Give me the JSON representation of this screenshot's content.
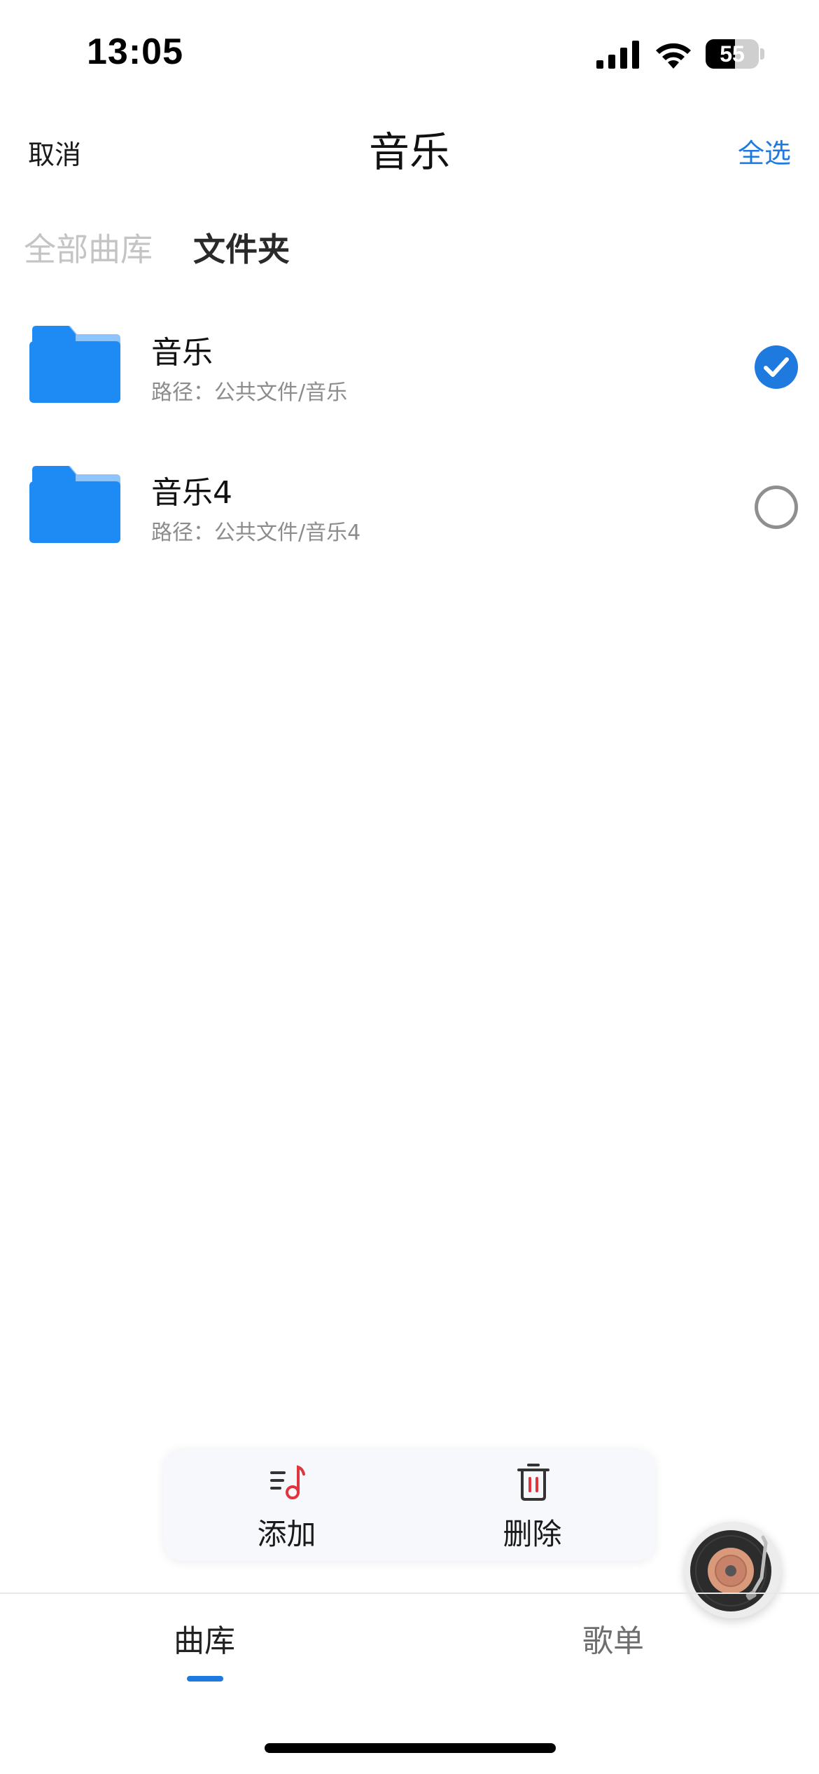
{
  "status_bar": {
    "time": "13:05",
    "battery": "55",
    "battery_level_percent": 55,
    "icons": [
      "signal-icon",
      "wifi-icon",
      "battery-icon"
    ]
  },
  "nav": {
    "cancel_label": "取消",
    "title": "音乐",
    "select_all_label": "全选"
  },
  "tabs": [
    {
      "label": "全部曲库",
      "active": false
    },
    {
      "label": "文件夹",
      "active": true
    }
  ],
  "folders": [
    {
      "name": "音乐",
      "path": "路径：公共文件/音乐",
      "selected": true
    },
    {
      "name": "音乐4",
      "path": "路径：公共文件/音乐4",
      "selected": false
    }
  ],
  "actions": {
    "add_label": "添加",
    "delete_label": "删除"
  },
  "bottom_tabs": [
    {
      "label": "曲库",
      "active": true
    },
    {
      "label": "歌单",
      "active": false
    }
  ],
  "colors": {
    "accent": "#1f7ae0",
    "folder_blue": "#1e8bf5",
    "folder_tab_light": "#8cc4fb",
    "add_icon_red": "#e0353d",
    "delete_icon_red": "#e0353d"
  }
}
